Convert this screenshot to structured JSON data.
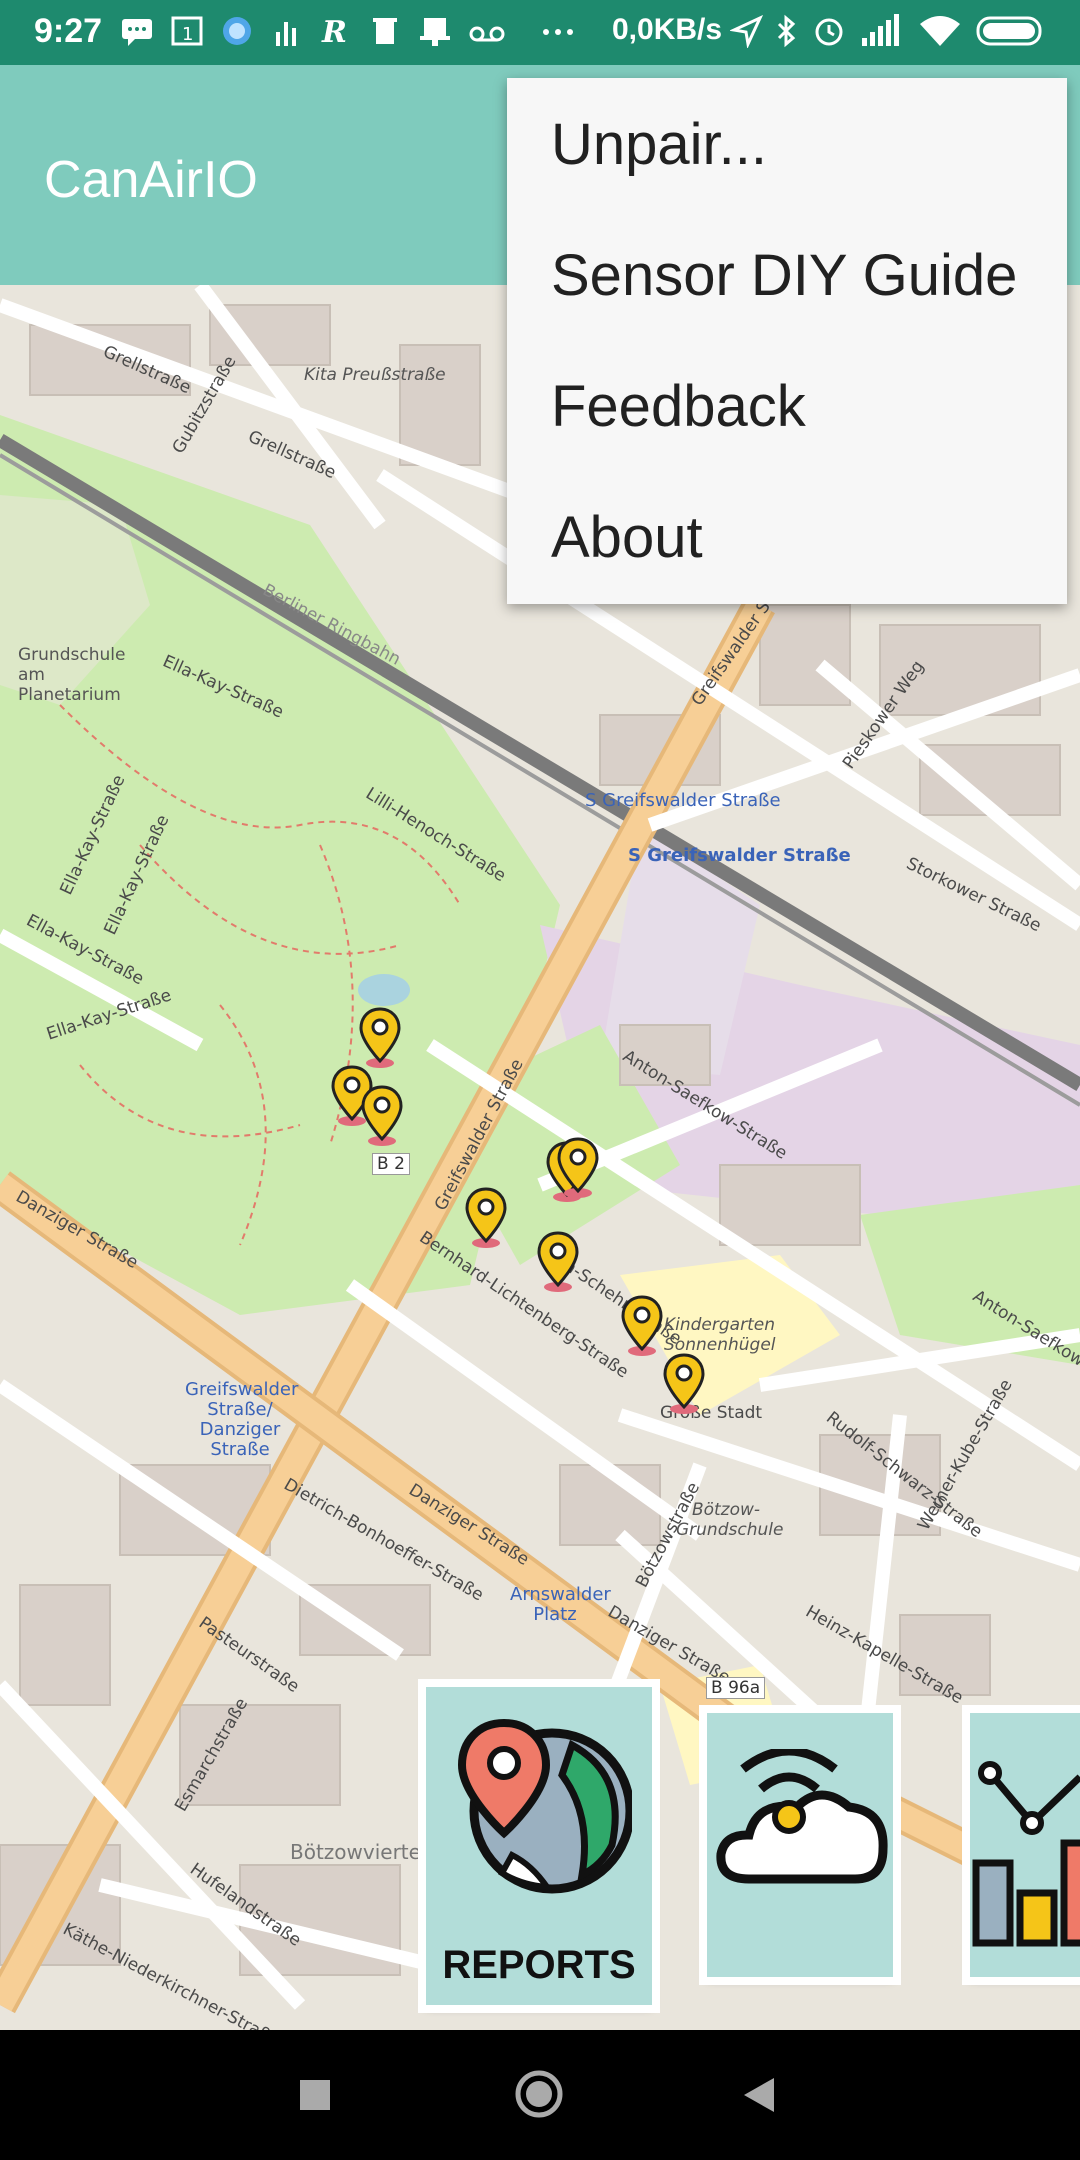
{
  "status_bar": {
    "time": "9:27",
    "network_speed": "0,0KB/s",
    "icons": [
      "message-icon",
      "calendar-icon",
      "browser-icon",
      "signal-bars-icon",
      "r-app-icon",
      "trash-icon",
      "hat-icon",
      "voicemail-icon",
      "more-dots-icon",
      "location-arrow-icon",
      "bluetooth-icon",
      "alarm-icon",
      "cell-signal-icon",
      "wifi-icon",
      "battery-icon"
    ]
  },
  "app_bar": {
    "title": "CanAirIO",
    "color": "#7fcbbd"
  },
  "overflow_menu": {
    "items": [
      {
        "label": "Unpair..."
      },
      {
        "label": "Sensor DIY Guide"
      },
      {
        "label": "Feedback"
      },
      {
        "label": "About"
      }
    ]
  },
  "map": {
    "labels": [
      "Grellstraße",
      "Gubitzstraße",
      "Grellstraße",
      "Kita Preußstraße",
      "Berliner Ringbahn",
      "Grundschule am Planetarium",
      "Ella-Kay-Straße",
      "Greifswalder Straße",
      "S Greifswalder Straße",
      "S Greifswalder Straße",
      "Lilli-Henoch-Straße",
      "Ella-Kay-Straße",
      "Ella-Kay-Straße",
      "Ella-Kay-Straße",
      "Ella-Kay-Straße",
      "Storkower Straße",
      "Pieskower Weg",
      "Greifswalder Straße",
      "Anton-Saefkow-Straße",
      "B 2",
      "Danziger Straße",
      "Bernhard-Lichtenberg-Straße",
      "John-Schehr-Straße",
      "Kindergarten Sonnenhügel",
      "Greifswalder Straße/ Danziger Straße",
      "Danziger Straße",
      "Dietrich-Bonhoeffer-Straße",
      "Arnswalder Platz",
      "Bötzow-Grundschule",
      "Rudolf-Schwarz-Straße",
      "Pasteurstraße",
      "Esmarchstraße",
      "Bötzowviertel",
      "Hufelandstraße",
      "Danziger Straße",
      "B 96a",
      "Heinz-Kapelle-Straße",
      "Käthe-Niederkirchner-Straße",
      "Bötzowstraße",
      "Werner-Kube-Straße",
      "Anton-Saefkow-Straße",
      "Große Stadt"
    ],
    "marker_color": "#f5c518"
  },
  "cards": [
    {
      "name": "reports",
      "label": "REPORTS",
      "icon": "map-globe-pin-icon"
    },
    {
      "name": "sensor-cloud",
      "label": "",
      "icon": "cloud-wifi-icon"
    },
    {
      "name": "charts",
      "label": "",
      "icon": "bar-chart-icon"
    }
  ],
  "nav_bar": {
    "buttons": [
      "recents-button",
      "home-button",
      "back-button"
    ]
  }
}
